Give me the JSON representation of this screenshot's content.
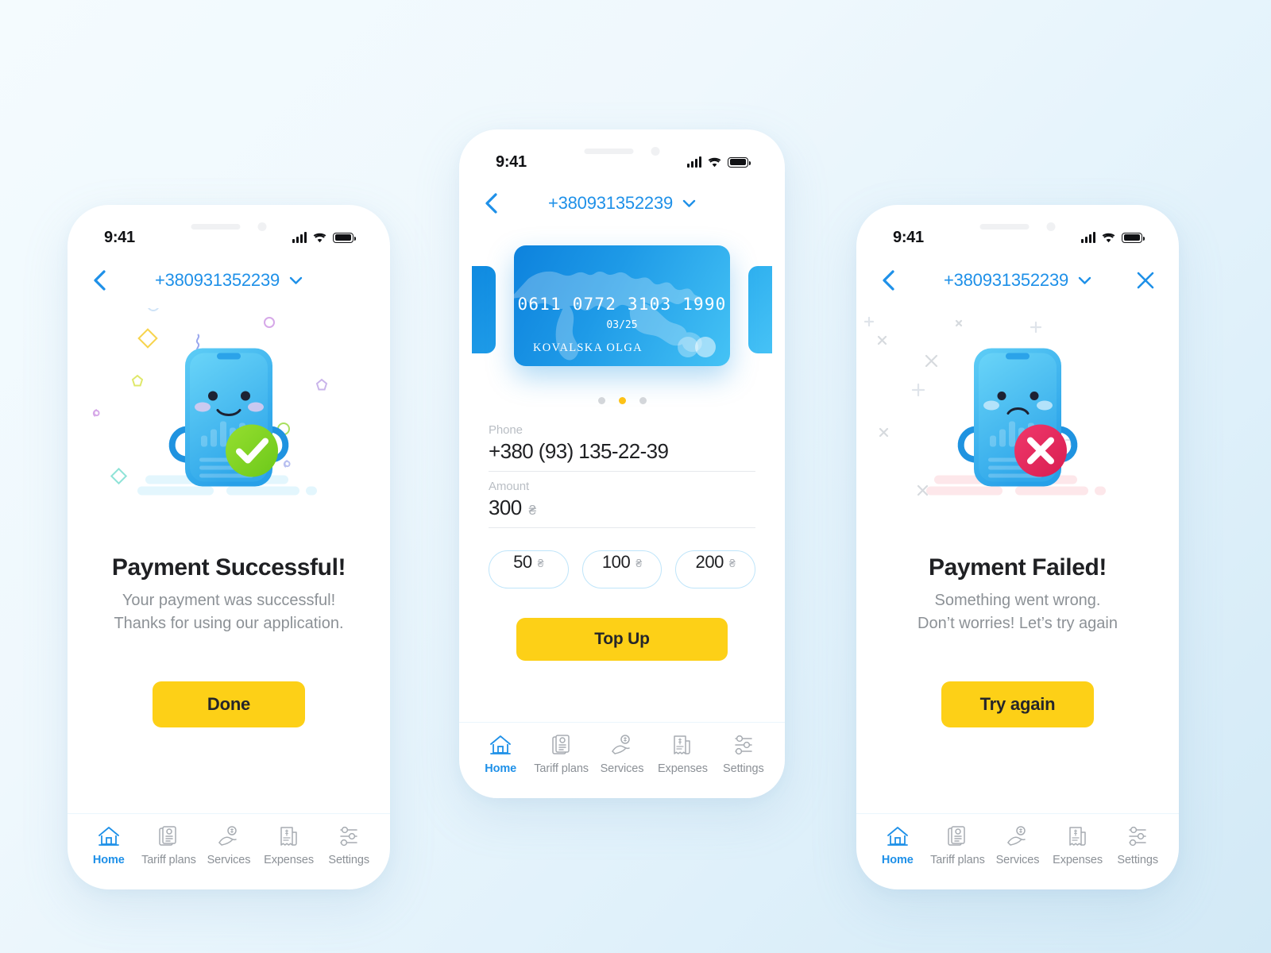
{
  "background": {
    "from": "#f4fbfe",
    "to": "#d2e9f6"
  },
  "colors": {
    "accent_blue": "#1e90e8",
    "accent_yellow": "#fdd017",
    "success_green": "#7ed321",
    "error_red": "#e8275a",
    "text_dark": "#1f2023",
    "text_muted": "#8c9196"
  },
  "status_bar": {
    "time": "9:41",
    "signal_icon": "signal-bars-icon",
    "wifi_icon": "wifi-icon",
    "battery_icon": "battery-full-icon"
  },
  "nav": {
    "back_icon": "chevron-left-icon",
    "phone_number": "+380931352239",
    "dropdown_icon": "chevron-down-icon",
    "close_icon": "close-x-icon"
  },
  "tabbar": {
    "items": [
      {
        "label": "Home",
        "icon": "home-icon",
        "active": true
      },
      {
        "label": "Tariff plans",
        "icon": "document-icon",
        "active": false
      },
      {
        "label": "Services",
        "icon": "hand-coin-icon",
        "active": false
      },
      {
        "label": "Expenses",
        "icon": "receipt-icon",
        "active": false
      },
      {
        "label": "Settings",
        "icon": "sliders-icon",
        "active": false
      }
    ]
  },
  "screen_success": {
    "illustration": "happy-phone-mascot-with-check-illustration",
    "badge_icon": "check-circle-icon",
    "title": "Payment Successful!",
    "subtitle_line1": "Your payment was successful!",
    "subtitle_line2": "Thanks for using our application.",
    "button_label": "Done"
  },
  "screen_topup": {
    "carousel": {
      "card": {
        "number": "0611 0772 3103 1990",
        "expiry": "03/25",
        "holder": "KOVALSKA OLGA",
        "logo_icon": "mastercard-circles-icon"
      },
      "dots": [
        {
          "active": false
        },
        {
          "active": true
        },
        {
          "active": false
        }
      ]
    },
    "phone_field": {
      "label": "Phone",
      "value": "+380 (93) 135-22-39"
    },
    "amount_field": {
      "label": "Amount",
      "value": "300",
      "currency": "₴"
    },
    "quick_amounts": [
      {
        "value": "50",
        "currency": "₴"
      },
      {
        "value": "100",
        "currency": "₴"
      },
      {
        "value": "200",
        "currency": "₴"
      }
    ],
    "button_label": "Top Up"
  },
  "screen_failed": {
    "illustration": "sad-phone-mascot-with-cross-illustration",
    "badge_icon": "x-circle-icon",
    "title": "Payment Failed!",
    "subtitle_line1": "Something went wrong.",
    "subtitle_line2": "Don’t worries! Let’s try again",
    "button_label": "Try again"
  }
}
